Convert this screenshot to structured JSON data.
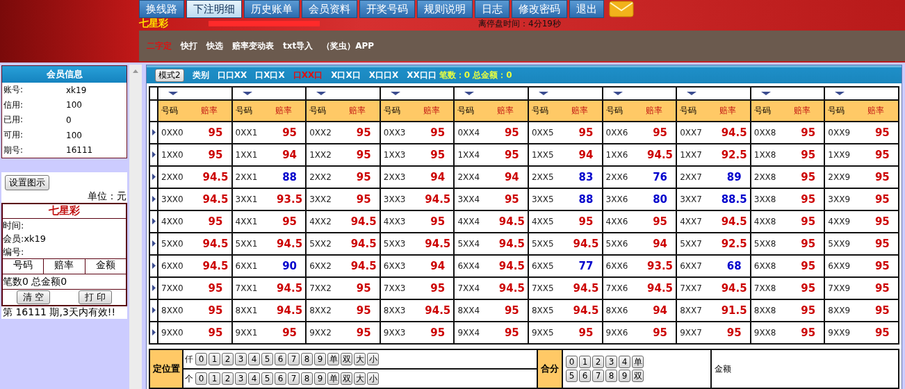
{
  "nav_tabs": [
    {
      "label": "换线路",
      "selected": false
    },
    {
      "label": "下注明细",
      "selected": true
    },
    {
      "label": "历史账单",
      "selected": false
    },
    {
      "label": "会员资料",
      "selected": false
    },
    {
      "label": "开奖号码",
      "selected": false
    },
    {
      "label": "规则说明",
      "selected": false
    },
    {
      "label": "日志",
      "selected": false
    },
    {
      "label": "修改密码",
      "selected": false
    },
    {
      "label": "退出",
      "selected": false
    }
  ],
  "lottery_name": "七星彩",
  "countdown": "离停盘时间：4分19秒",
  "sub_nav": [
    {
      "label": "二字定",
      "selected": true
    },
    {
      "label": "快打",
      "selected": false
    },
    {
      "label": "快选",
      "selected": false
    },
    {
      "label": "赔率变动表",
      "selected": false
    },
    {
      "label": "txt导入",
      "selected": false
    },
    {
      "label": "（奖虫）APP",
      "selected": false
    }
  ],
  "member_info": {
    "title": "会员信息",
    "fields": [
      {
        "label": "账号:",
        "value": "xk19"
      },
      {
        "label": "信用:",
        "value": "100"
      },
      {
        "label": "已用:",
        "value": "0"
      },
      {
        "label": "可用:",
        "value": "100"
      },
      {
        "label": "期号:",
        "value": "16111"
      }
    ]
  },
  "settings_button": "设置图示",
  "unit": "单位：元",
  "ticket": {
    "title": "七星彩",
    "lines": [
      "时间:",
      "会员:xk19",
      "编号:"
    ],
    "columns": [
      "号码",
      "赔率",
      "金额"
    ],
    "summary": "笔数0 总金额0",
    "buttons": [
      "清 空",
      "打 印"
    ]
  },
  "validity": "第 16111 期,3天内有效!!",
  "mode_bar": {
    "mode_button": "模式2",
    "category": "类别",
    "modes": [
      {
        "label": "口口XX",
        "selected": false
      },
      {
        "label": "口X口X",
        "selected": false
      },
      {
        "label": "口XX口",
        "selected": true
      },
      {
        "label": "X口X口",
        "selected": false
      },
      {
        "label": "X口口X",
        "selected": false
      },
      {
        "label": "XX口口",
        "selected": false
      }
    ],
    "summary": "笔数：0 总金额：0"
  },
  "columns": [
    {
      "code_label": "号码",
      "odds_label": "赔率"
    },
    {
      "code_label": "号码",
      "odds_label": "赔率"
    },
    {
      "code_label": "号码",
      "odds_label": "赔率"
    },
    {
      "code_label": "号码",
      "odds_label": "赔率"
    },
    {
      "code_label": "号码",
      "odds_label": "赔率"
    },
    {
      "code_label": "号码",
      "odds_label": "赔率"
    },
    {
      "code_label": "号码",
      "odds_label": "赔率"
    },
    {
      "code_label": "号码",
      "odds_label": "赔率"
    },
    {
      "code_label": "号码",
      "odds_label": "赔率"
    },
    {
      "code_label": "号码",
      "odds_label": "赔率"
    }
  ],
  "rows": [
    [
      {
        "code": "0XX0",
        "odds": "95",
        "color": "#cc0000"
      },
      {
        "code": "0XX1",
        "odds": "95",
        "color": "#cc0000"
      },
      {
        "code": "0XX2",
        "odds": "95",
        "color": "#cc0000"
      },
      {
        "code": "0XX3",
        "odds": "95",
        "color": "#cc0000"
      },
      {
        "code": "0XX4",
        "odds": "95",
        "color": "#cc0000"
      },
      {
        "code": "0XX5",
        "odds": "95",
        "color": "#cc0000"
      },
      {
        "code": "0XX6",
        "odds": "95",
        "color": "#cc0000"
      },
      {
        "code": "0XX7",
        "odds": "94.5",
        "color": "#cc0000"
      },
      {
        "code": "0XX8",
        "odds": "95",
        "color": "#cc0000"
      },
      {
        "code": "0XX9",
        "odds": "95",
        "color": "#cc0000"
      }
    ],
    [
      {
        "code": "1XX0",
        "odds": "95",
        "color": "#cc0000"
      },
      {
        "code": "1XX1",
        "odds": "94",
        "color": "#cc0000"
      },
      {
        "code": "1XX2",
        "odds": "95",
        "color": "#cc0000"
      },
      {
        "code": "1XX3",
        "odds": "95",
        "color": "#cc0000"
      },
      {
        "code": "1XX4",
        "odds": "95",
        "color": "#cc0000"
      },
      {
        "code": "1XX5",
        "odds": "94",
        "color": "#cc0000"
      },
      {
        "code": "1XX6",
        "odds": "94.5",
        "color": "#cc0000"
      },
      {
        "code": "1XX7",
        "odds": "92.5",
        "color": "#cc0000"
      },
      {
        "code": "1XX8",
        "odds": "95",
        "color": "#cc0000"
      },
      {
        "code": "1XX9",
        "odds": "95",
        "color": "#cc0000"
      }
    ],
    [
      {
        "code": "2XX0",
        "odds": "94.5",
        "color": "#cc0000"
      },
      {
        "code": "2XX1",
        "odds": "88",
        "color": "#0000cc"
      },
      {
        "code": "2XX2",
        "odds": "95",
        "color": "#cc0000"
      },
      {
        "code": "2XX3",
        "odds": "94",
        "color": "#cc0000"
      },
      {
        "code": "2XX4",
        "odds": "94",
        "color": "#cc0000"
      },
      {
        "code": "2XX5",
        "odds": "83",
        "color": "#0000cc"
      },
      {
        "code": "2XX6",
        "odds": "76",
        "color": "#0000cc"
      },
      {
        "code": "2XX7",
        "odds": "89",
        "color": "#0000cc"
      },
      {
        "code": "2XX8",
        "odds": "95",
        "color": "#cc0000"
      },
      {
        "code": "2XX9",
        "odds": "95",
        "color": "#cc0000"
      }
    ],
    [
      {
        "code": "3XX0",
        "odds": "94.5",
        "color": "#cc0000"
      },
      {
        "code": "3XX1",
        "odds": "93.5",
        "color": "#cc0000"
      },
      {
        "code": "3XX2",
        "odds": "95",
        "color": "#cc0000"
      },
      {
        "code": "3XX3",
        "odds": "94.5",
        "color": "#cc0000"
      },
      {
        "code": "3XX4",
        "odds": "95",
        "color": "#cc0000"
      },
      {
        "code": "3XX5",
        "odds": "88",
        "color": "#0000cc"
      },
      {
        "code": "3XX6",
        "odds": "80",
        "color": "#0000cc"
      },
      {
        "code": "3XX7",
        "odds": "88.5",
        "color": "#0000cc"
      },
      {
        "code": "3XX8",
        "odds": "95",
        "color": "#cc0000"
      },
      {
        "code": "3XX9",
        "odds": "95",
        "color": "#cc0000"
      }
    ],
    [
      {
        "code": "4XX0",
        "odds": "95",
        "color": "#cc0000"
      },
      {
        "code": "4XX1",
        "odds": "95",
        "color": "#cc0000"
      },
      {
        "code": "4XX2",
        "odds": "94.5",
        "color": "#cc0000"
      },
      {
        "code": "4XX3",
        "odds": "95",
        "color": "#cc0000"
      },
      {
        "code": "4XX4",
        "odds": "94.5",
        "color": "#cc0000"
      },
      {
        "code": "4XX5",
        "odds": "95",
        "color": "#cc0000"
      },
      {
        "code": "4XX6",
        "odds": "95",
        "color": "#cc0000"
      },
      {
        "code": "4XX7",
        "odds": "94.5",
        "color": "#cc0000"
      },
      {
        "code": "4XX8",
        "odds": "95",
        "color": "#cc0000"
      },
      {
        "code": "4XX9",
        "odds": "95",
        "color": "#cc0000"
      }
    ],
    [
      {
        "code": "5XX0",
        "odds": "94.5",
        "color": "#cc0000"
      },
      {
        "code": "5XX1",
        "odds": "94.5",
        "color": "#cc0000"
      },
      {
        "code": "5XX2",
        "odds": "94.5",
        "color": "#cc0000"
      },
      {
        "code": "5XX3",
        "odds": "94.5",
        "color": "#cc0000"
      },
      {
        "code": "5XX4",
        "odds": "94.5",
        "color": "#cc0000"
      },
      {
        "code": "5XX5",
        "odds": "94.5",
        "color": "#cc0000"
      },
      {
        "code": "5XX6",
        "odds": "94",
        "color": "#cc0000"
      },
      {
        "code": "5XX7",
        "odds": "92.5",
        "color": "#cc0000"
      },
      {
        "code": "5XX8",
        "odds": "95",
        "color": "#cc0000"
      },
      {
        "code": "5XX9",
        "odds": "95",
        "color": "#cc0000"
      }
    ],
    [
      {
        "code": "6XX0",
        "odds": "94.5",
        "color": "#cc0000"
      },
      {
        "code": "6XX1",
        "odds": "90",
        "color": "#0000cc"
      },
      {
        "code": "6XX2",
        "odds": "94.5",
        "color": "#cc0000"
      },
      {
        "code": "6XX3",
        "odds": "94",
        "color": "#cc0000"
      },
      {
        "code": "6XX4",
        "odds": "94.5",
        "color": "#cc0000"
      },
      {
        "code": "6XX5",
        "odds": "77",
        "color": "#0000cc"
      },
      {
        "code": "6XX6",
        "odds": "93.5",
        "color": "#cc0000"
      },
      {
        "code": "6XX7",
        "odds": "68",
        "color": "#0000cc"
      },
      {
        "code": "6XX8",
        "odds": "95",
        "color": "#cc0000"
      },
      {
        "code": "6XX9",
        "odds": "95",
        "color": "#cc0000"
      }
    ],
    [
      {
        "code": "7XX0",
        "odds": "95",
        "color": "#cc0000"
      },
      {
        "code": "7XX1",
        "odds": "94.5",
        "color": "#cc0000"
      },
      {
        "code": "7XX2",
        "odds": "95",
        "color": "#cc0000"
      },
      {
        "code": "7XX3",
        "odds": "95",
        "color": "#cc0000"
      },
      {
        "code": "7XX4",
        "odds": "94.5",
        "color": "#cc0000"
      },
      {
        "code": "7XX5",
        "odds": "94.5",
        "color": "#cc0000"
      },
      {
        "code": "7XX6",
        "odds": "94.5",
        "color": "#cc0000"
      },
      {
        "code": "7XX7",
        "odds": "94.5",
        "color": "#cc0000"
      },
      {
        "code": "7XX8",
        "odds": "95",
        "color": "#cc0000"
      },
      {
        "code": "7XX9",
        "odds": "95",
        "color": "#cc0000"
      }
    ],
    [
      {
        "code": "8XX0",
        "odds": "95",
        "color": "#cc0000"
      },
      {
        "code": "8XX1",
        "odds": "94.5",
        "color": "#cc0000"
      },
      {
        "code": "8XX2",
        "odds": "95",
        "color": "#cc0000"
      },
      {
        "code": "8XX3",
        "odds": "94.5",
        "color": "#cc0000"
      },
      {
        "code": "8XX4",
        "odds": "95",
        "color": "#cc0000"
      },
      {
        "code": "8XX5",
        "odds": "94.5",
        "color": "#cc0000"
      },
      {
        "code": "8XX6",
        "odds": "94",
        "color": "#cc0000"
      },
      {
        "code": "8XX7",
        "odds": "91.5",
        "color": "#cc0000"
      },
      {
        "code": "8XX8",
        "odds": "95",
        "color": "#cc0000"
      },
      {
        "code": "8XX9",
        "odds": "95",
        "color": "#cc0000"
      }
    ],
    [
      {
        "code": "9XX0",
        "odds": "95",
        "color": "#cc0000"
      },
      {
        "code": "9XX1",
        "odds": "95",
        "color": "#cc0000"
      },
      {
        "code": "9XX2",
        "odds": "95",
        "color": "#cc0000"
      },
      {
        "code": "9XX3",
        "odds": "95",
        "color": "#cc0000"
      },
      {
        "code": "9XX4",
        "odds": "95",
        "color": "#cc0000"
      },
      {
        "code": "9XX5",
        "odds": "95",
        "color": "#cc0000"
      },
      {
        "code": "9XX6",
        "odds": "95",
        "color": "#cc0000"
      },
      {
        "code": "9XX7",
        "odds": "95",
        "color": "#cc0000"
      },
      {
        "code": "9XX8",
        "odds": "95",
        "color": "#cc0000"
      },
      {
        "code": "9XX9",
        "odds": "95",
        "color": "#cc0000"
      }
    ]
  ],
  "position_panel": {
    "title": "定位置",
    "lines": [
      {
        "label": "仟",
        "keys": [
          "0",
          "1",
          "2",
          "3",
          "4",
          "5",
          "6",
          "7",
          "8",
          "9",
          "单",
          "双",
          "大",
          "小"
        ]
      },
      {
        "label": "个",
        "keys": [
          "0",
          "1",
          "2",
          "3",
          "4",
          "5",
          "6",
          "7",
          "8",
          "9",
          "单",
          "双",
          "大",
          "小"
        ]
      }
    ]
  },
  "sum_panel": {
    "title": "合分",
    "key_rows": [
      [
        "0",
        "1",
        "2",
        "3",
        "4",
        "单"
      ],
      [
        "5",
        "6",
        "7",
        "8",
        "9",
        "双"
      ]
    ]
  },
  "amount_label": "金额"
}
